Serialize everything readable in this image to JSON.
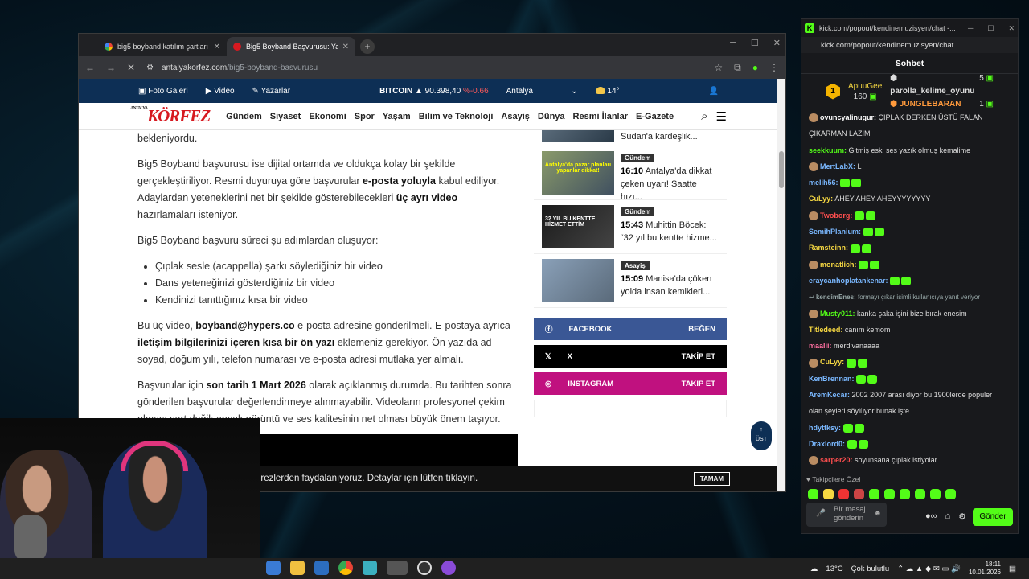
{
  "browser": {
    "tabs": [
      {
        "title": "big5 boyband katılım şartları - Goo"
      },
      {
        "title": "Big5 Boyband Başvurusu: Yaş Sı"
      }
    ],
    "url_domain": "antalyakorfez.com",
    "url_path": "/big5-boyband-basvurusu"
  },
  "site": {
    "topbar": {
      "foto": "Foto Galeri",
      "video": "Video",
      "yazarlar": "Yazarlar",
      "bitcoin_label": "BITCOIN",
      "bitcoin_value": "90.398,40",
      "bitcoin_change": "%-0.66",
      "city": "Antalya",
      "temp": "14°"
    },
    "logo_small": "ANTALYA",
    "logo": "KÖRFEZ",
    "nav": [
      "Gündem",
      "Siyaset",
      "Ekonomi",
      "Spor",
      "Yaşam",
      "Bilim ve Teknoloji",
      "Asayiş",
      "Dünya",
      "Resmi İlanlar",
      "E-Gazete"
    ]
  },
  "article": {
    "p0": "bekleniyordu.",
    "p1_a": "Big5 Boyband başvurusu ise dijital ortamda ve oldukça kolay bir şekilde gerçekleştiriliyor. Resmi duyuruya göre başvurular ",
    "p1_b1": "e-posta yoluyla",
    "p1_c": " kabul ediliyor. Adaylardan yeteneklerini net bir şekilde gösterebilecekleri ",
    "p1_b2": "üç ayrı video",
    "p1_d": " hazırlamaları isteniyor.",
    "p2": "Big5 Boyband başvuru süreci şu adımlardan oluşuyor:",
    "list": [
      "Çıplak sesle (acappella) şarkı söylediğiniz bir video",
      "Dans yeteneğinizi gösterdiğiniz bir video",
      "Kendinizi tanıttığınız kısa bir video"
    ],
    "p3_a": "Bu üç video, ",
    "p3_b1": "boyband@hypers.co",
    "p3_c": " e-posta adresine gönderilmeli. E-postaya ayrıca ",
    "p3_b2": "iletişim bilgilerinizi içeren kısa bir ön yazı",
    "p3_d": " eklemeniz gerekiyor. Ön yazıda ad-soyad, doğum yılı, telefon numarası ve e-posta adresi mutlaka yer almalı.",
    "p4_a": "Başvurular için ",
    "p4_b": "son tarih 1 Mart 2026",
    "p4_c": " olarak açıklanmış durumda. Bu tarihten sonra gönderilen başvurular değerlendirmeye alınmayabilir. Videoların profesyonel çekim olması şart değil; ancak görüntü ve ses kalitesinin net olması büyük önem taşıyor."
  },
  "sidebar": {
    "top_partial": "Sudan'a kardeşlik...",
    "news": [
      {
        "tag": "Gündem",
        "time": "16:10",
        "text": "Antalya'da dikkat çeken uyarı! Saatte hızı...",
        "thumb_text": "Antalya'da pazar planları yapanlar dikkat!"
      },
      {
        "tag": "Gündem",
        "time": "15:43",
        "text": "Muhittin Böcek: “32 yıl bu kentte hizme...",
        "thumb_text": "32 YIL BU KENTTE HİZMET ETTİM"
      },
      {
        "tag": "Asayiş",
        "time": "15:09",
        "text": "Manisa'da çöken yolda insan kemikleri...",
        "thumb_text": ""
      }
    ],
    "social": [
      {
        "name": "FACEBOOK",
        "action": "BEĞEN"
      },
      {
        "name": "X",
        "action": "TAKİP ET"
      },
      {
        "name": "INSTAGRAM",
        "action": "TAKİP ET"
      }
    ]
  },
  "totop": "ÜST",
  "cookie": {
    "text": "erezlerden faydalanıyoruz. Detaylar için lütfen tıklayın.",
    "ok": "TAMAM"
  },
  "chat": {
    "window_title": "kick.com/popout/kendinemuzisyen/chat -...",
    "url": "kick.com/popout/kendinemuzisyen/chat",
    "header": "Sohbet",
    "pinned": {
      "user": "ApuuGee",
      "amount": "160",
      "poll1": "parolla_kelime_oyunu",
      "poll1_n": "5",
      "poll2": "JUNGLEBARAN",
      "poll2_n": "1"
    },
    "messages": [
      {
        "user": "ovuncyalinugur:",
        "color": "#ffffff",
        "text": "ÇIPLAK DERKEN ÜSTÜ FALAN"
      },
      {
        "user": "",
        "color": "#ffffff",
        "text": "ÇIKARMAN LAZIM"
      },
      {
        "user": "seekkuum:",
        "color": "#53fc18",
        "text": "Gitmiş eski ses yazık olmuş kemalime"
      },
      {
        "user": "MertLabX:",
        "color": "#7ab8ff",
        "text": "L"
      },
      {
        "user": "melih56:",
        "color": "#7ab8ff",
        "text": ""
      },
      {
        "user": "CuLyy:",
        "color": "#f5d742",
        "text": "AHEY AHEY AHEYYYYYYYY"
      },
      {
        "user": "Twoborg:",
        "color": "#ff4f4f",
        "text": ""
      },
      {
        "user": "SemihPlanium:",
        "color": "#7ab8ff",
        "text": ""
      },
      {
        "user": "Ramsteinn:",
        "color": "#f5d742",
        "text": ""
      },
      {
        "user": "monatlich:",
        "color": "#f5d742",
        "text": ""
      },
      {
        "user": "eraycanhoplatankenar:",
        "color": "#7ab8ff",
        "text": ""
      },
      {
        "user": "kendimEnes:",
        "color": "#9aa",
        "text": "formayı çıkar isimli kullanıcıya yanıt veriyor",
        "reply": true
      },
      {
        "user": "Musty011:",
        "color": "#53fc18",
        "text": "kanka şaka işini bize bırak enesim"
      },
      {
        "user": "Titledeed:",
        "color": "#f5d742",
        "text": "canım kemom"
      },
      {
        "user": "maalii:",
        "color": "#ff6fa1",
        "text": "merdivanaaaa"
      },
      {
        "user": "CuLyy:",
        "color": "#f5d742",
        "text": ""
      },
      {
        "user": "KenBrennan:",
        "color": "#7ab8ff",
        "text": ""
      },
      {
        "user": "AremKecar:",
        "color": "#7ab8ff",
        "text": "2002 2007 arası diyor bu 1900lerde populer"
      },
      {
        "user": "",
        "color": "#ffffff",
        "text": "olan şeyleri söylüyor bunak işte"
      },
      {
        "user": "hdyttksy:",
        "color": "#7ab8ff",
        "text": ""
      },
      {
        "user": "Draxlord0:",
        "color": "#7ab8ff",
        "text": ""
      },
      {
        "user": "sarper20:",
        "color": "#ff4f4f",
        "text": "soyunsana çıplak istiyolar"
      }
    ],
    "followers_label": "Takipçilere Özel",
    "input_placeholder": "Bir mesaj gönderin",
    "send": "Gönder"
  },
  "taskbar": {
    "weather_temp": "13°C",
    "weather_text": "Çok bulutlu",
    "time": "18:11",
    "date": "10.01.2026"
  }
}
